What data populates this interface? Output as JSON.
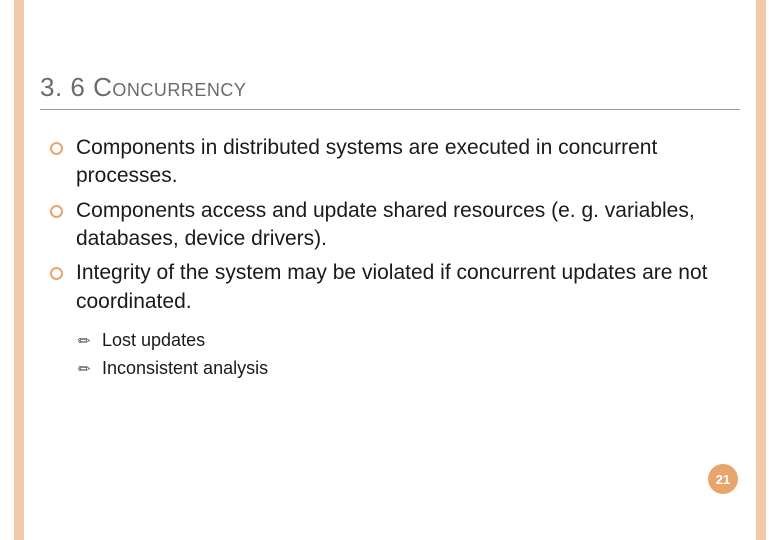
{
  "title": {
    "number": "3. 6",
    "text": "Concurrency"
  },
  "bullets": [
    "Components in distributed systems are executed in concurrent processes.",
    "Components access and update shared resources (e. g. variables, databases, device drivers).",
    "Integrity of the system may be violated if concurrent updates are not coordinated."
  ],
  "subbullets": [
    "Lost updates",
    "Inconsistent analysis"
  ],
  "page_number": "21"
}
